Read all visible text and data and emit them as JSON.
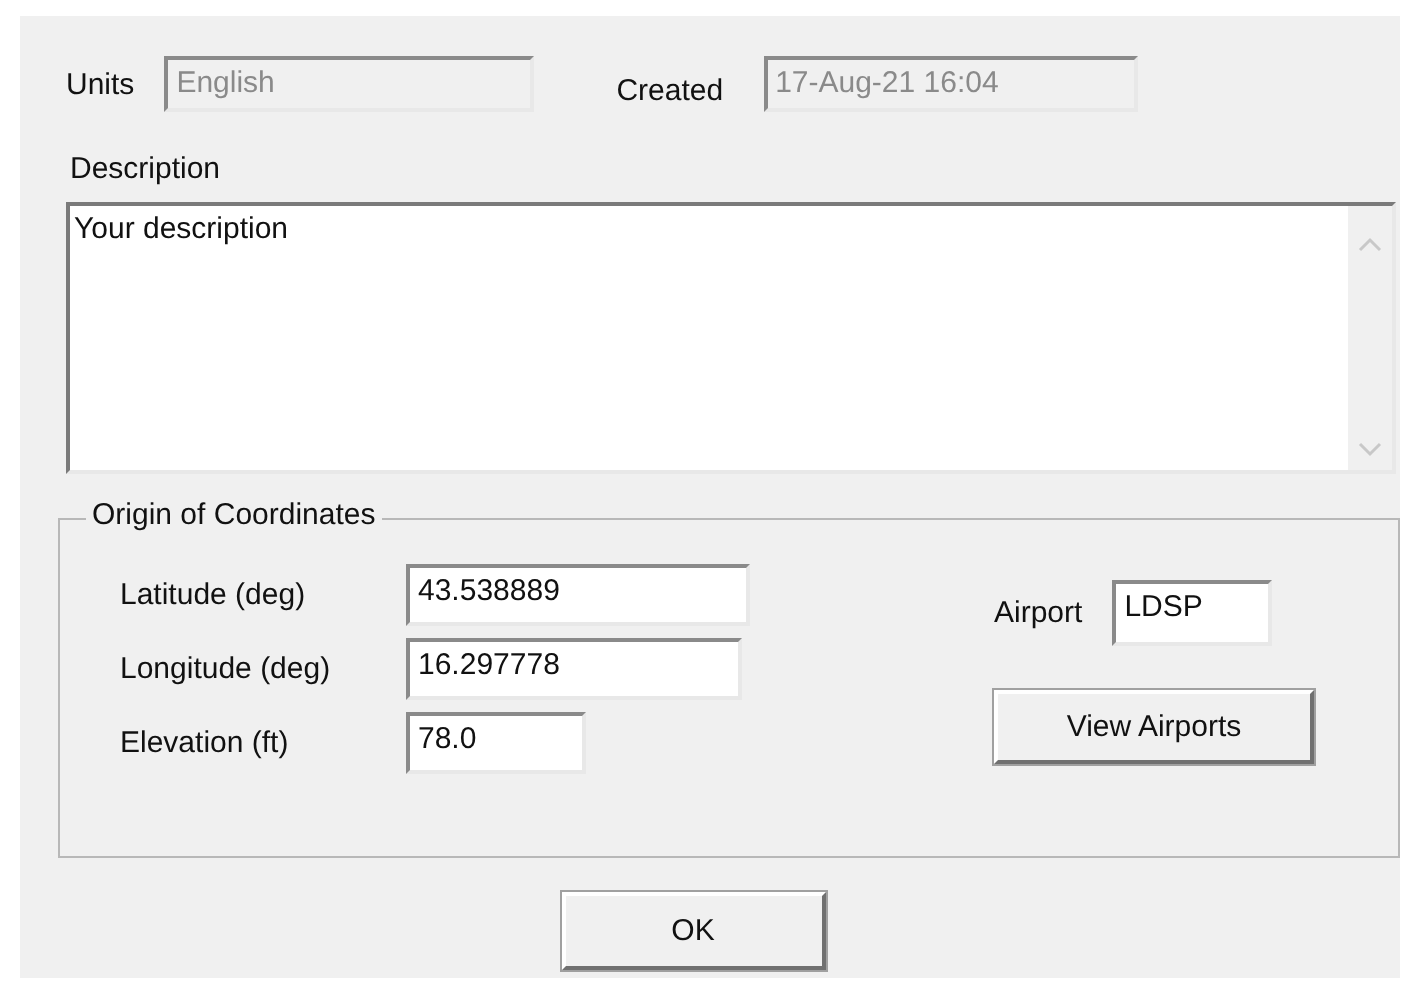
{
  "units": {
    "label": "Units",
    "value": "English",
    "disabled": true
  },
  "created": {
    "label": "Created",
    "value": "17-Aug-21 16:04",
    "disabled": true
  },
  "description": {
    "label": "Description",
    "value": "Your description"
  },
  "origin": {
    "title": "Origin of Coordinates",
    "fields": [
      {
        "label": "Latitude (deg)",
        "value": "43.538889"
      },
      {
        "label": "Longitude (deg)",
        "value": "16.297778"
      },
      {
        "label": "Elevation (ft)",
        "value": "78.0"
      }
    ],
    "airport": {
      "label": "Airport",
      "value": "LDSP"
    },
    "view_button": "View Airports"
  },
  "ok_button": "OK"
}
